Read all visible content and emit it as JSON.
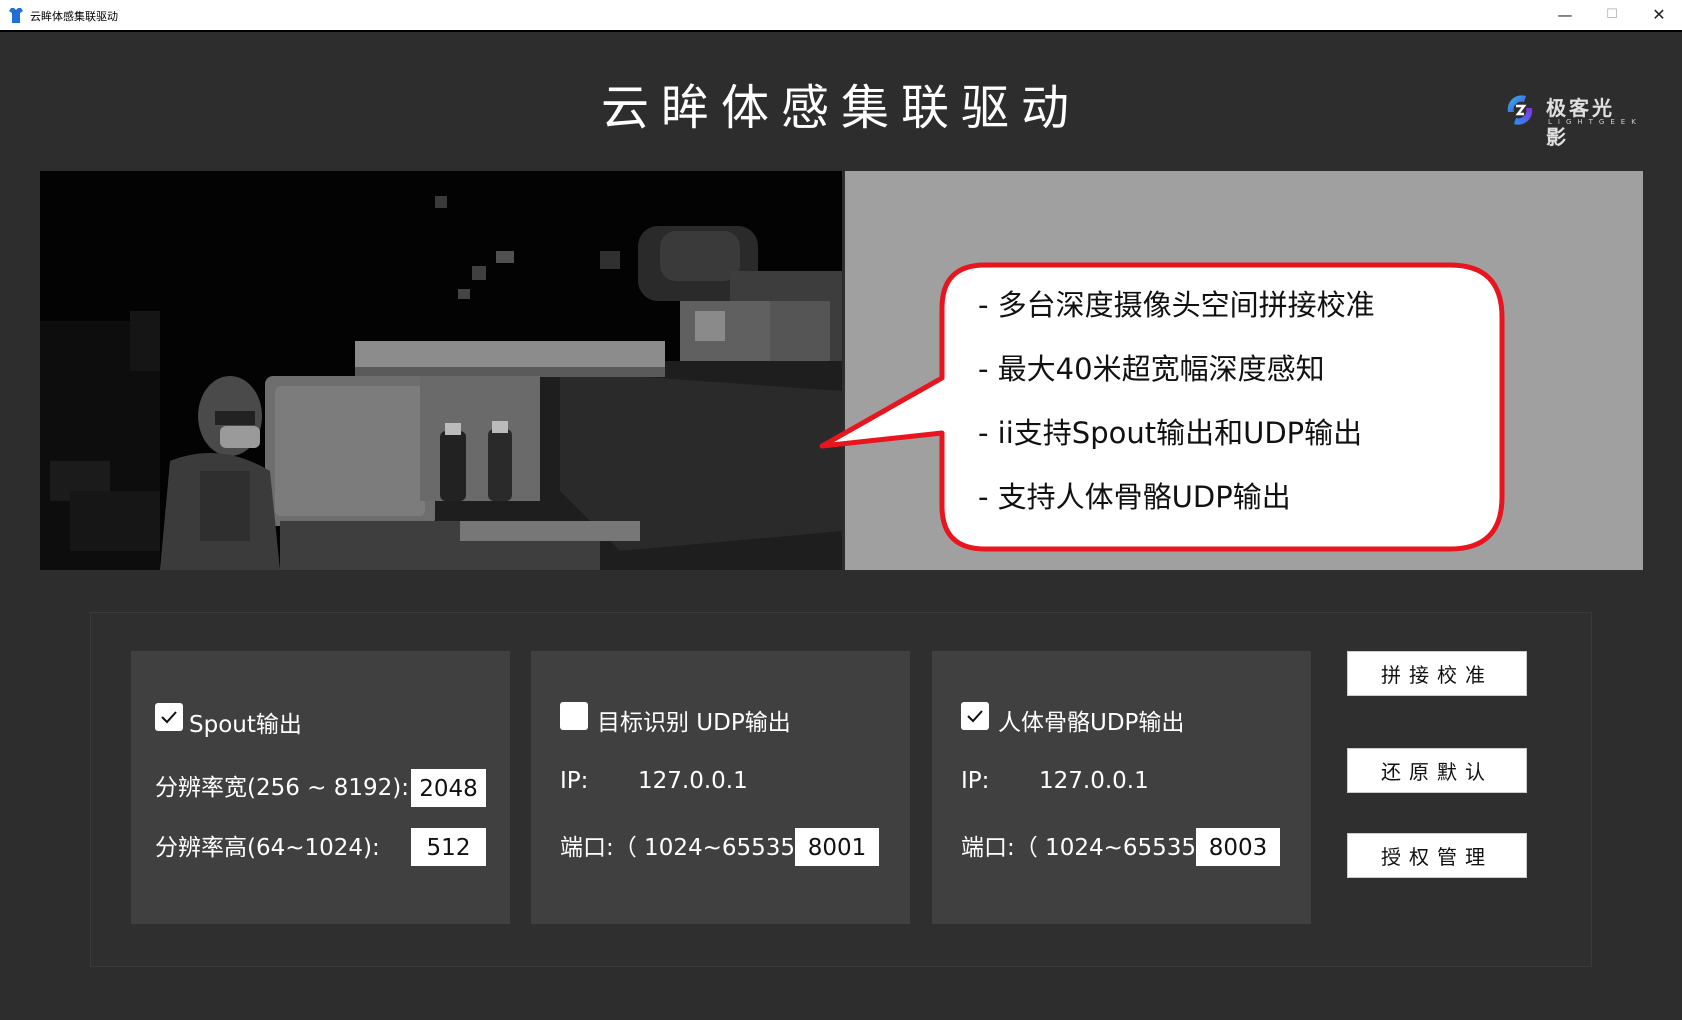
{
  "window": {
    "title": "云眸体感集联驱动",
    "min_glyph": "—",
    "max_glyph": "☐",
    "close_glyph": "✕"
  },
  "header": {
    "title": "云眸体感集联驱动",
    "logo_cn": "极客光影",
    "logo_en": "LIGHTGEEK"
  },
  "callout": {
    "lines": [
      "- 多台深度摄像头空间拼接校准",
      "- 最大40米超宽幅深度感知",
      "- ii支持Spout输出和UDP输出",
      "- 支持人体骨骼UDP输出"
    ],
    "border_color": "#e8141e"
  },
  "spout": {
    "checked": true,
    "label": "Spout输出",
    "width_label": "分辨率宽(256 ~ 8192):",
    "width_value": "2048",
    "height_label": "分辨率高(64~1024):",
    "height_value": "512"
  },
  "target_udp": {
    "checked": false,
    "label": "目标识别 UDP输出",
    "ip_label": "IP:",
    "ip_value": "127.0.0.1",
    "port_label": "端口:（ 1024~65535 ）",
    "port_value": "8001"
  },
  "skeleton_udp": {
    "checked": true,
    "label": "人体骨骼UDP输出",
    "ip_label": "IP:",
    "ip_value": "127.0.0.1",
    "port_label": "端口:（ 1024~65535 ）",
    "port_value": "8003"
  },
  "buttons": {
    "stitch": "拼接校准",
    "reset": "还原默认",
    "license": "授权管理"
  }
}
